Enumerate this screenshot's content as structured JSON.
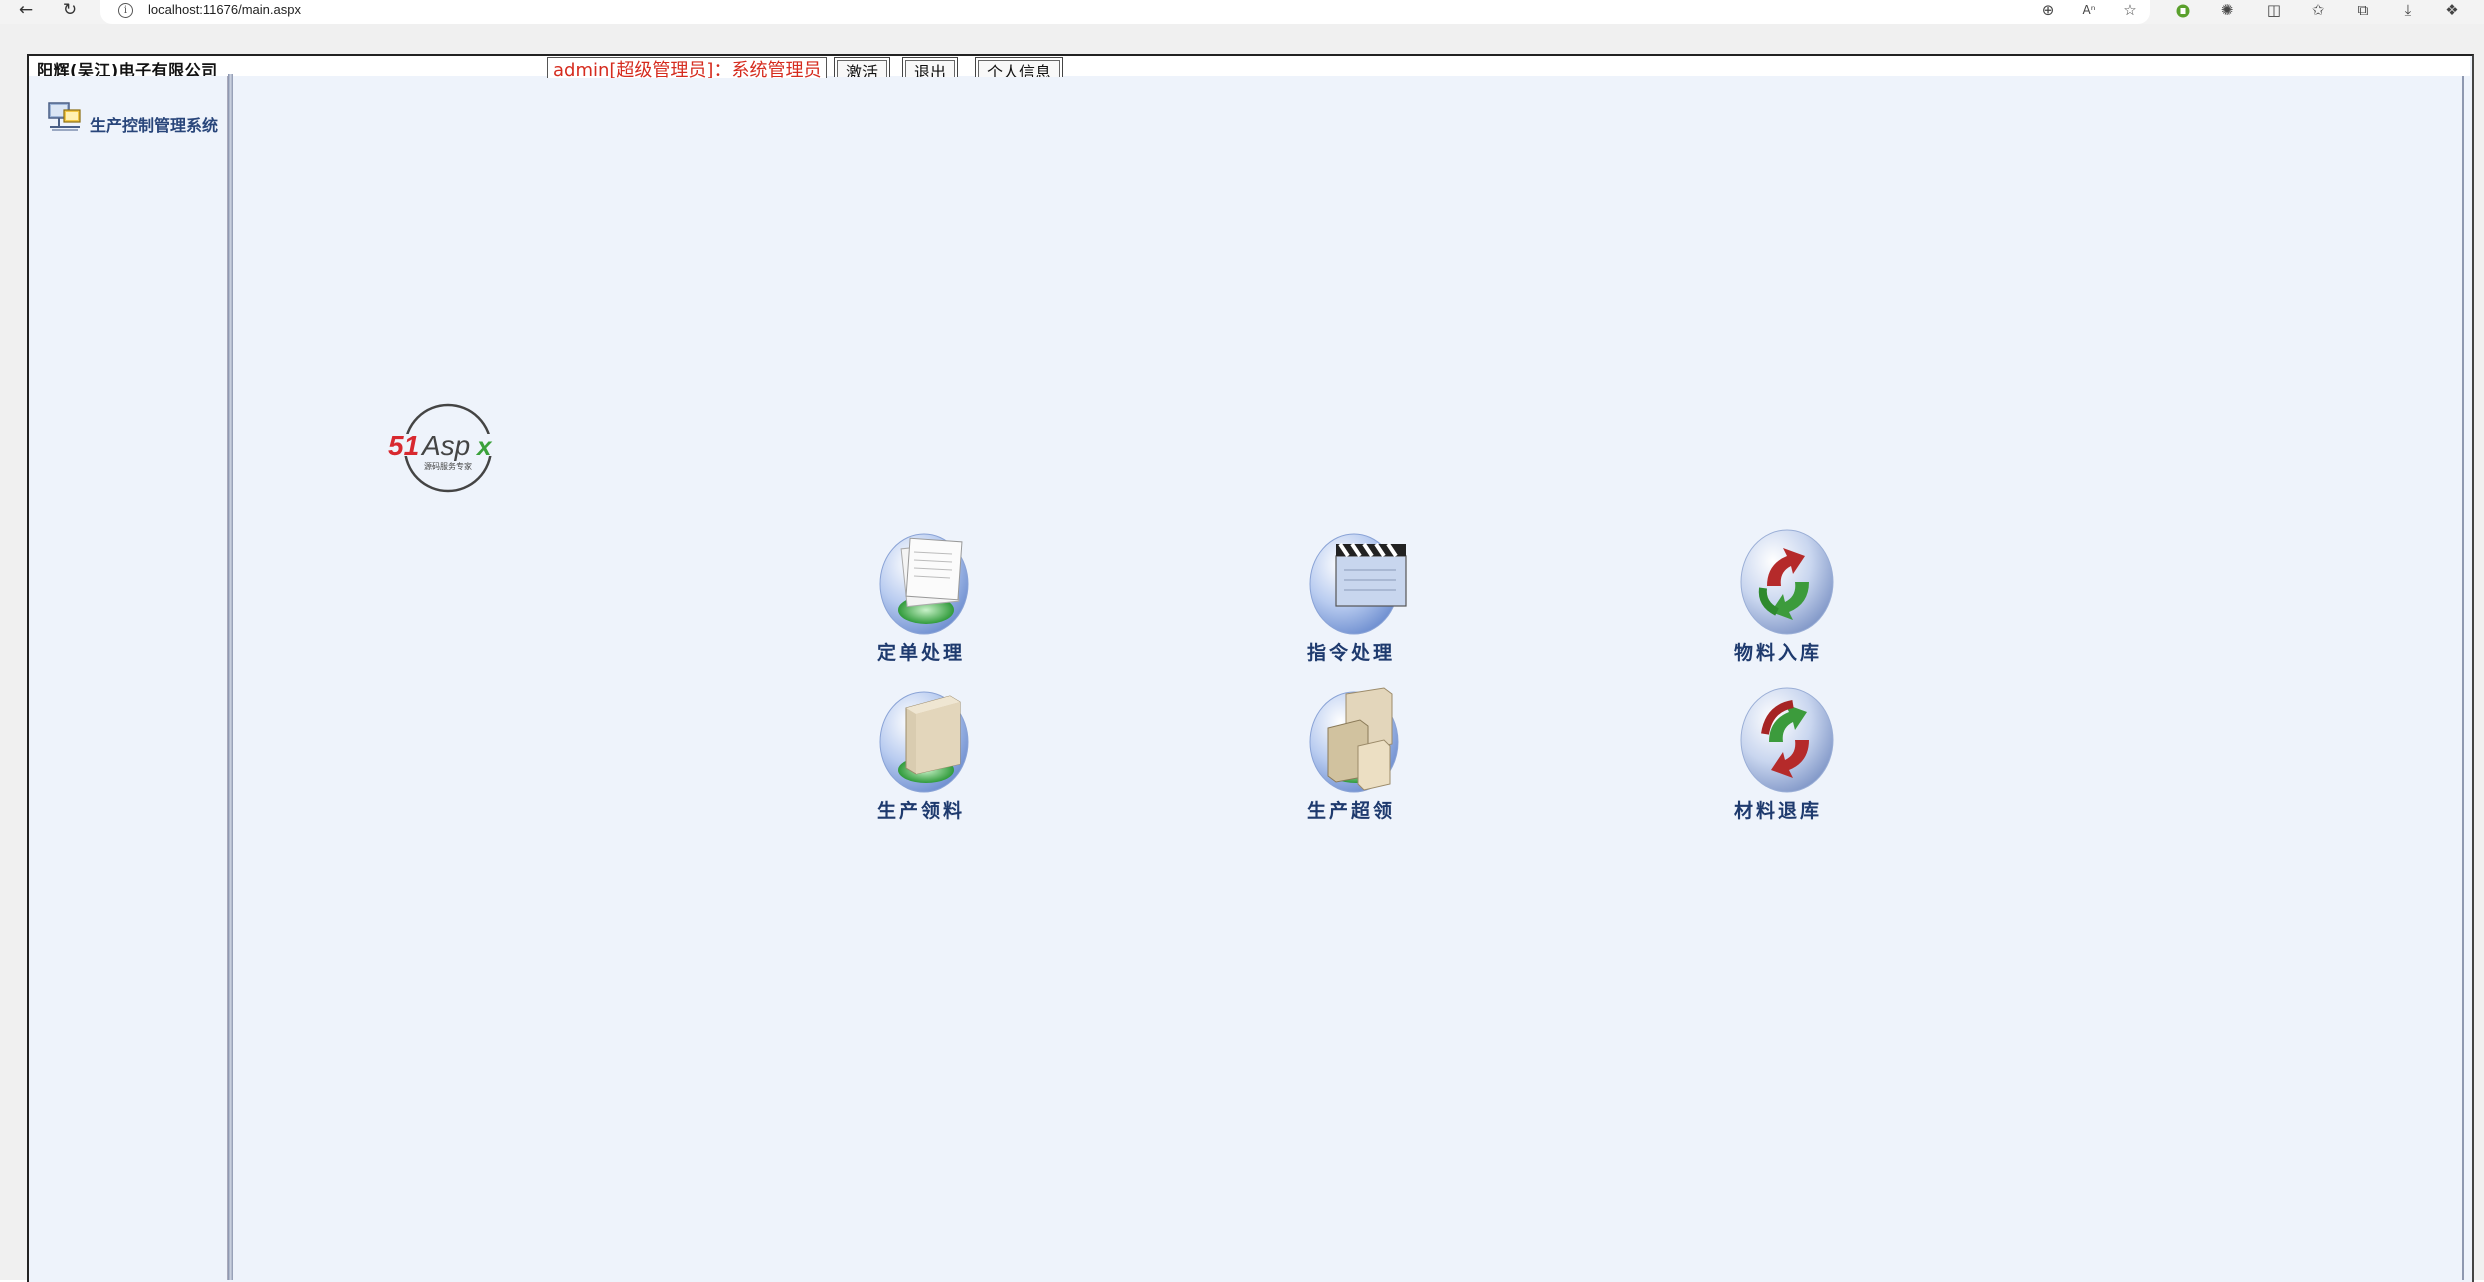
{
  "browser": {
    "url": "localhost:11676/main.aspx",
    "icons": [
      "back-icon",
      "reload-icon",
      "site-info-icon",
      "zoom-icon",
      "read-aloud-icon",
      "favorite-star-icon",
      "extension-icon",
      "puzzle-icon",
      "split-screen-icon",
      "favorites-icon",
      "collections-icon",
      "downloads-icon",
      "copilot-icon"
    ]
  },
  "header": {
    "company": "阳辉(吴江)电子有限公司",
    "user_info": "admin[超级管理员]：系统管理员",
    "buttons": {
      "activate": "激活",
      "logout": "退出",
      "profile": "个人信息"
    }
  },
  "sidebar": {
    "system_label": "生产控制管理系统"
  },
  "logo": {
    "brand": "51Aspx",
    "tagline": "源码服务专家"
  },
  "tiles": [
    {
      "label": "定单处理",
      "icon": "documents-icon"
    },
    {
      "label": "指令处理",
      "icon": "clapperboard-icon"
    },
    {
      "label": "物料入库",
      "icon": "stock-in-arrows-icon"
    },
    {
      "label": "生产领料",
      "icon": "box-icon"
    },
    {
      "label": "生产超领",
      "icon": "boxes-icon"
    },
    {
      "label": "材料退库",
      "icon": "return-arrows-icon"
    }
  ],
  "colors": {
    "content_bg": "#eef3fb",
    "label_color": "#1e3a6e",
    "user_text": "#d52b1e"
  }
}
